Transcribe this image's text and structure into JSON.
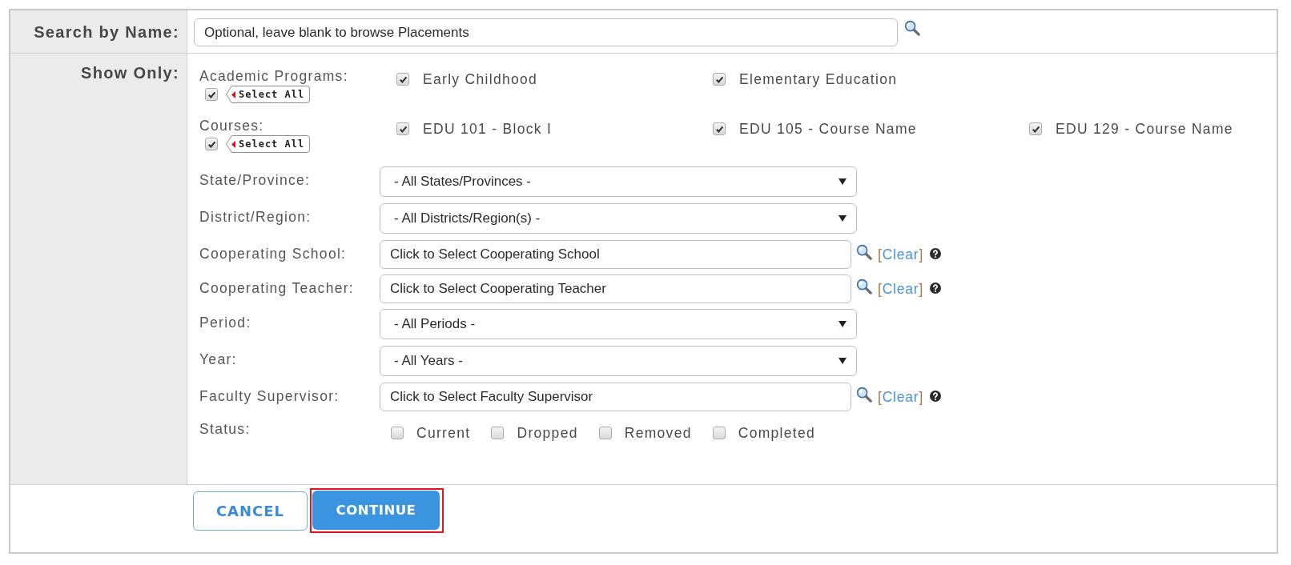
{
  "search": {
    "label": "Search by Name:",
    "placeholder": "Optional, leave blank to browse Placements"
  },
  "filters": {
    "label": "Show Only:",
    "rows": [
      {
        "kind": "checkbox_group",
        "label": "Academic Programs:",
        "select_all": {
          "label": "Select All",
          "checked": true
        },
        "options": [
          {
            "label": "Early Childhood",
            "checked": true
          },
          {
            "label": "Elementary Education",
            "checked": true
          }
        ]
      },
      {
        "kind": "checkbox_group",
        "label": "Courses:",
        "select_all": {
          "label": "Select All",
          "checked": true
        },
        "options": [
          {
            "label": "EDU 101 - Block I",
            "checked": true
          },
          {
            "label": "EDU 105 - Course Name",
            "checked": true
          },
          {
            "label": "EDU 129 - Course Name",
            "checked": true
          }
        ]
      },
      {
        "kind": "dropdown",
        "label": "State/Province:",
        "value": "- All States/Provinces -"
      },
      {
        "kind": "dropdown",
        "label": "District/Region:",
        "value": "- All Districts/Region(s) -"
      },
      {
        "kind": "lookup",
        "label": "Cooperating School:",
        "placeholder": "Click to Select Cooperating School",
        "clear_link": "[Clear]"
      },
      {
        "kind": "lookup",
        "label": "Cooperating Teacher:",
        "placeholder": "Click to Select Cooperating Teacher",
        "clear_link": "[Clear]"
      },
      {
        "kind": "dropdown",
        "label": "Period:",
        "value": "- All Periods -"
      },
      {
        "kind": "dropdown",
        "label": "Year:",
        "value": "- All Years -"
      },
      {
        "kind": "lookup",
        "label": "Faculty Supervisor:",
        "placeholder": "Click to Select Faculty Supervisor",
        "clear_link": "[Clear]"
      },
      {
        "kind": "checkbox_inline",
        "label": "Status:",
        "options": [
          {
            "label": "Current",
            "checked": false
          },
          {
            "label": "Dropped",
            "checked": false
          },
          {
            "label": "Removed",
            "checked": false
          },
          {
            "label": "Completed",
            "checked": false
          }
        ]
      }
    ]
  },
  "buttons": [
    {
      "label": "CANCEL",
      "kind": "secondary",
      "highlighted": false
    },
    {
      "label": "CONTINUE",
      "kind": "primary",
      "highlighted": true
    }
  ]
}
